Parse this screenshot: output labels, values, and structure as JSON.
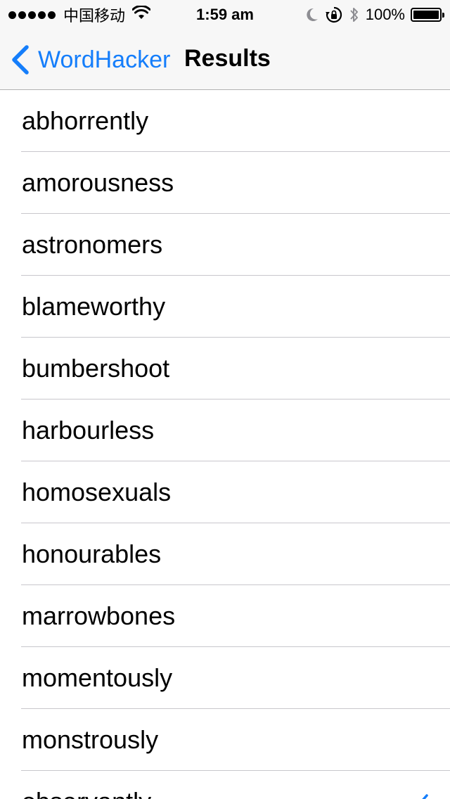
{
  "status_bar": {
    "carrier": "中国移动",
    "time": "1:59 am",
    "battery_percent": "100%",
    "battery_level": 1.0,
    "signal_bars": 5
  },
  "nav": {
    "back_label": "WordHacker",
    "title": "Results"
  },
  "colors": {
    "accent": "#157efb",
    "separator": "#c8c7cc",
    "bar_background": "#f7f7f7"
  },
  "results": [
    {
      "word": "abhorrently"
    },
    {
      "word": "amorousness"
    },
    {
      "word": "astronomers"
    },
    {
      "word": "blameworthy"
    },
    {
      "word": "bumbershoot"
    },
    {
      "word": "harbourless"
    },
    {
      "word": "homosexuals"
    },
    {
      "word": "honourables"
    },
    {
      "word": "marrowbones"
    },
    {
      "word": "momentously"
    },
    {
      "word": "monstrously"
    },
    {
      "word": "observantly",
      "checked": true
    }
  ]
}
